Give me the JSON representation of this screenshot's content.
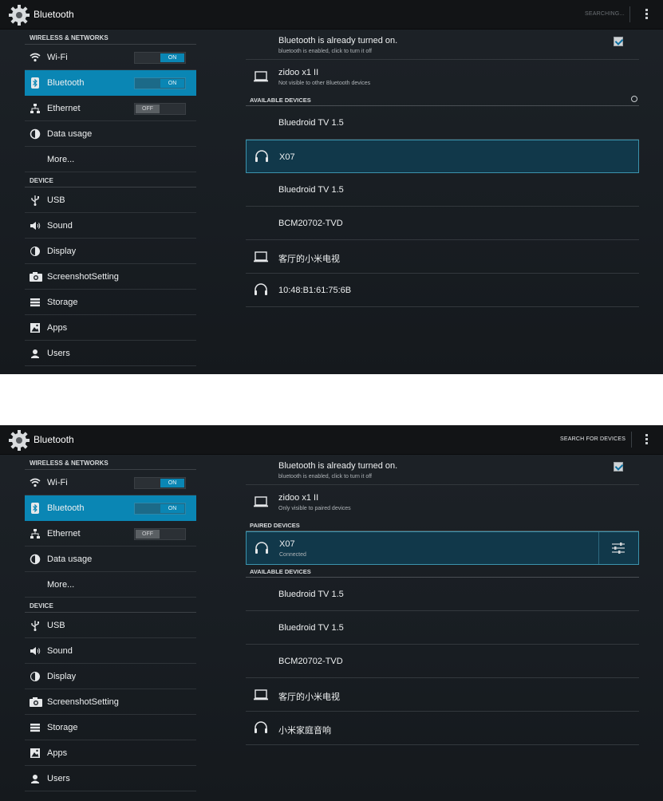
{
  "screen1": {
    "actionbar": {
      "title": "Bluetooth",
      "action": "SEARCHING..."
    },
    "sidebar": {
      "section1": "WIRELESS & NETWORKS",
      "items1": [
        {
          "label": "Wi-Fi",
          "toggle": "ON",
          "icon": "wifi-icon"
        },
        {
          "label": "Bluetooth",
          "toggle": "ON",
          "icon": "bluetooth-icon"
        },
        {
          "label": "Ethernet",
          "toggle": "OFF",
          "icon": "ethernet-icon"
        },
        {
          "label": "Data usage",
          "icon": "data-usage-icon"
        },
        {
          "label": "More...",
          "icon": ""
        }
      ],
      "section2": "DEVICE",
      "items2": [
        {
          "label": "USB",
          "icon": "usb-icon"
        },
        {
          "label": "Sound",
          "icon": "sound-icon"
        },
        {
          "label": "Display",
          "icon": "display-icon"
        },
        {
          "label": "ScreenshotSetting",
          "icon": "camera-icon"
        },
        {
          "label": "Storage",
          "icon": "storage-icon"
        },
        {
          "label": "Apps",
          "icon": "apps-icon"
        },
        {
          "label": "Users",
          "icon": "users-icon"
        }
      ]
    },
    "main": {
      "bt_title": "Bluetooth is already turned on.",
      "bt_sub": "bluetooth is enabled, click to turn it off",
      "device_name": "zidoo x1 II",
      "device_sub": "Not visible to other Bluetooth devices",
      "available_header": "AVAILABLE DEVICES",
      "available": [
        {
          "name": "Bluedroid TV 1.5",
          "icon": ""
        },
        {
          "name": "X07",
          "icon": "headphones-icon"
        },
        {
          "name": "Bluedroid TV 1.5",
          "icon": ""
        },
        {
          "name": "BCM20702-TVD",
          "icon": ""
        },
        {
          "name": "客厅的小米电视",
          "icon": "laptop-icon"
        },
        {
          "name": "10:48:B1:61:75:6B",
          "icon": "headphones-icon"
        }
      ]
    }
  },
  "screen2": {
    "actionbar": {
      "title": "Bluetooth",
      "action": "SEARCH FOR DEVICES"
    },
    "sidebar": {
      "section1": "WIRELESS & NETWORKS",
      "items1": [
        {
          "label": "Wi-Fi",
          "toggle": "ON"
        },
        {
          "label": "Bluetooth",
          "toggle": "ON"
        },
        {
          "label": "Ethernet",
          "toggle": "OFF"
        },
        {
          "label": "Data usage"
        },
        {
          "label": "More..."
        }
      ],
      "section2": "DEVICE",
      "items2": [
        {
          "label": "USB"
        },
        {
          "label": "Sound"
        },
        {
          "label": "Display"
        },
        {
          "label": "ScreenshotSetting"
        },
        {
          "label": "Storage"
        },
        {
          "label": "Apps"
        },
        {
          "label": "Users"
        }
      ]
    },
    "main": {
      "bt_title": "Bluetooth is already turned on.",
      "bt_sub": "bluetooth is enabled, click to turn it off",
      "device_name": "zidoo x1 II",
      "device_sub": "Only visible to paired devices",
      "paired_header": "PAIRED DEVICES",
      "paired": {
        "name": "X07",
        "status": "Connected"
      },
      "available_header": "AVAILABLE DEVICES",
      "available": [
        {
          "name": "Bluedroid TV 1.5",
          "icon": ""
        },
        {
          "name": "Bluedroid TV 1.5",
          "icon": ""
        },
        {
          "name": "BCM20702-TVD",
          "icon": ""
        },
        {
          "name": "客厅的小米电视",
          "icon": "laptop-icon"
        },
        {
          "name": "小米家庭音响",
          "icon": "headphones-icon"
        }
      ]
    }
  },
  "colors": {
    "accent": "#0a86b4",
    "background": "#1a1f24",
    "actionbar": "#121416",
    "highlight": "#11384a"
  }
}
